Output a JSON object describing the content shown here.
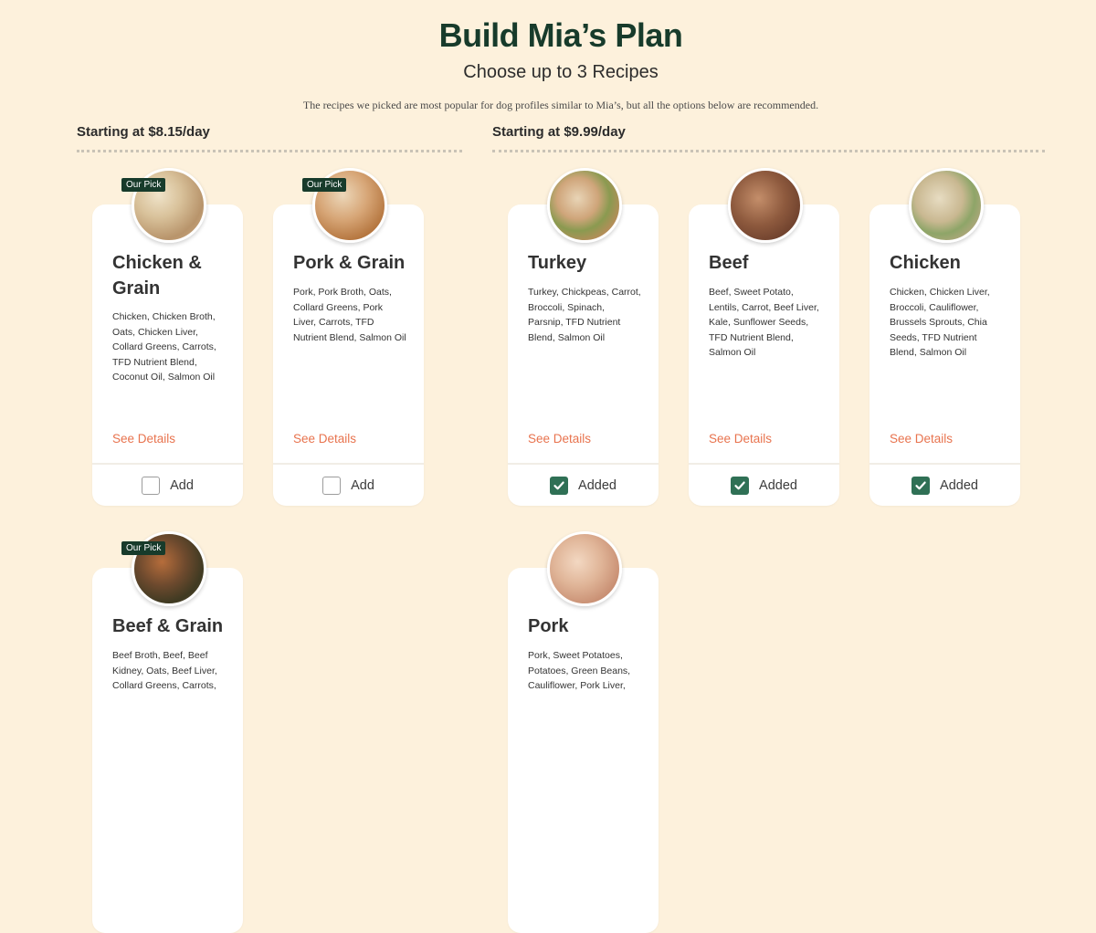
{
  "header": {
    "title": "Build Mia’s Plan",
    "subtitle": "Choose up to 3 Recipes",
    "note": "The recipes we picked are most popular for dog profiles similar to Mia’s, but all the options below are recommended."
  },
  "groups": [
    {
      "price_label": "Starting at $8.15/day"
    },
    {
      "price_label": "Starting at $9.99/day"
    }
  ],
  "recipes": [
    {
      "name": "Chicken & Grain",
      "badge": "Our Pick",
      "ingredients": "Chicken, Chicken Broth, Oats, Chicken Liver, Collard Greens, Carrots, TFD Nutrient Blend, Coconut Oil, Salmon Oil",
      "details": "See Details",
      "action": "Add",
      "selected": false
    },
    {
      "name": "Pork & Grain",
      "badge": "Our Pick",
      "ingredients": "Pork, Pork Broth, Oats, Collard Greens, Pork Liver, Carrots, TFD Nutrient Blend, Salmon Oil",
      "details": "See Details",
      "action": "Add",
      "selected": false
    },
    {
      "name": "Turkey",
      "ingredients": "Turkey, Chickpeas, Carrot, Broccoli, Spinach, Parsnip, TFD Nutrient Blend, Salmon Oil",
      "details": "See Details",
      "action": "Added",
      "selected": true
    },
    {
      "name": "Beef",
      "ingredients": "Beef, Sweet Potato, Lentils, Carrot, Beef Liver, Kale, Sunflower Seeds, TFD Nutrient Blend, Salmon Oil",
      "details": "See Details",
      "action": "Added",
      "selected": true
    },
    {
      "name": "Chicken",
      "ingredients": "Chicken, Chicken Liver, Broccoli, Cauliflower, Brussels Sprouts, Chia Seeds, TFD Nutrient Blend, Salmon Oil",
      "details": "See Details",
      "action": "Added",
      "selected": true
    },
    {
      "name": "Beef & Grain",
      "badge": "Our Pick",
      "ingredients": "Beef Broth, Beef, Beef Kidney, Oats, Beef Liver, Collard Greens, Carrots,"
    },
    {
      "name": "Pork",
      "ingredients": "Pork, Sweet Potatoes, Potatoes, Green Beans, Cauliflower, Pork Liver,"
    }
  ],
  "colors": {
    "background": "#fdf1dc",
    "title": "#173b2b",
    "accent_link": "#e8734e",
    "checked": "#2f7055",
    "badge": "#173b2b"
  }
}
